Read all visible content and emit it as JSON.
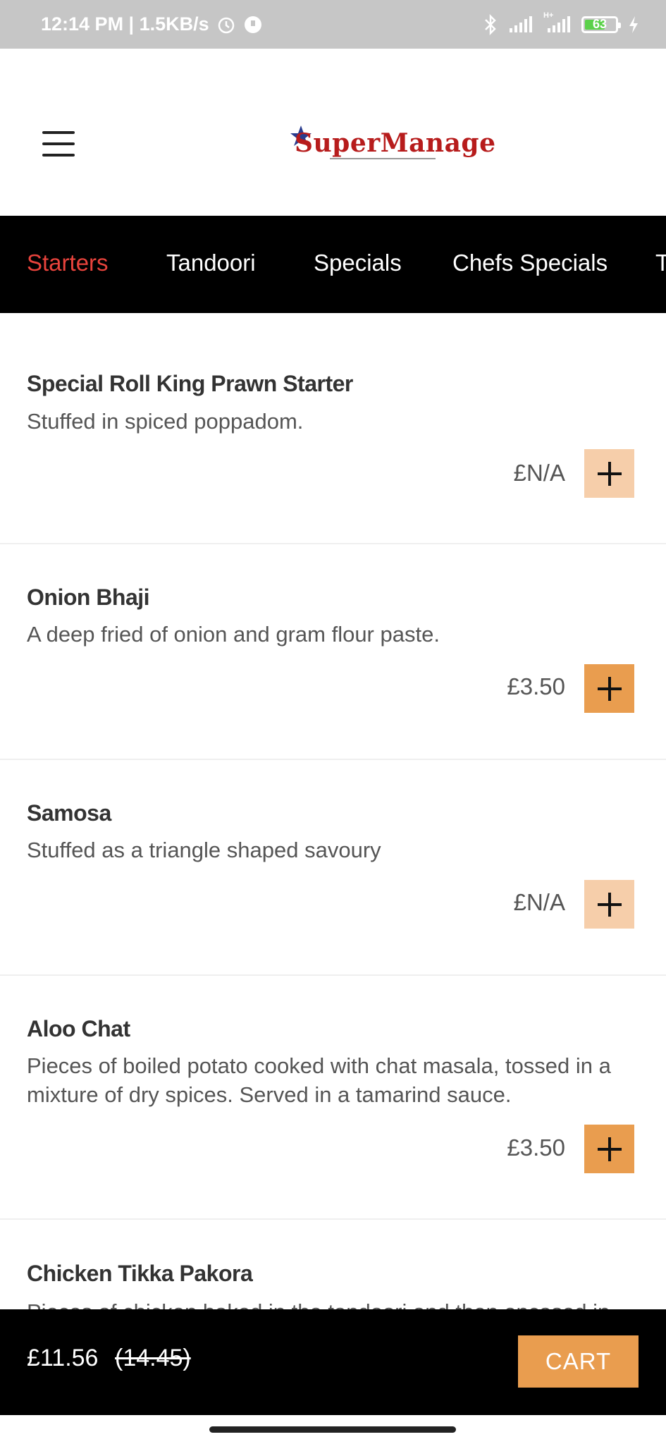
{
  "status_bar": {
    "time_speed": "12:14 PM | 1.5KB/s",
    "network_label": "H+",
    "battery_level": "63"
  },
  "header": {
    "logo_text": "SuperManage"
  },
  "categories": [
    {
      "label": "Starters",
      "active": true
    },
    {
      "label": "Tandoori",
      "active": false
    },
    {
      "label": "Specials",
      "active": false
    },
    {
      "label": "Chefs Specials",
      "active": false
    },
    {
      "label": "T",
      "active": false
    }
  ],
  "menu_items": [
    {
      "name": "Special Roll King Prawn Starter",
      "description": "Stuffed in spiced poppadom.",
      "price": "£N/A",
      "available": false
    },
    {
      "name": "Onion Bhaji",
      "description": "A deep fried of onion and gram flour paste.",
      "price": "£3.50",
      "available": true
    },
    {
      "name": "Samosa",
      "description": "Stuffed as a triangle shaped savoury",
      "price": "£N/A",
      "available": false
    },
    {
      "name": "Aloo Chat",
      "description": "Pieces of boiled potato cooked with chat masala, tossed in a mixture of dry spices. Served in a tamarind sauce.",
      "price": "£3.50",
      "available": true
    },
    {
      "name": "Chicken Tikka Pakora",
      "description": "Pieces of chicken baked in the tandoori and then encased in",
      "price": "",
      "available": false
    }
  ],
  "cart": {
    "total": "£11.56",
    "original": "(14.45)",
    "button_label": "CART"
  },
  "colors": {
    "accent_orange": "#e99d4f",
    "disabled_orange": "#f6ceaa",
    "active_tab_red": "#e8433c",
    "nav_background": "#000000"
  }
}
